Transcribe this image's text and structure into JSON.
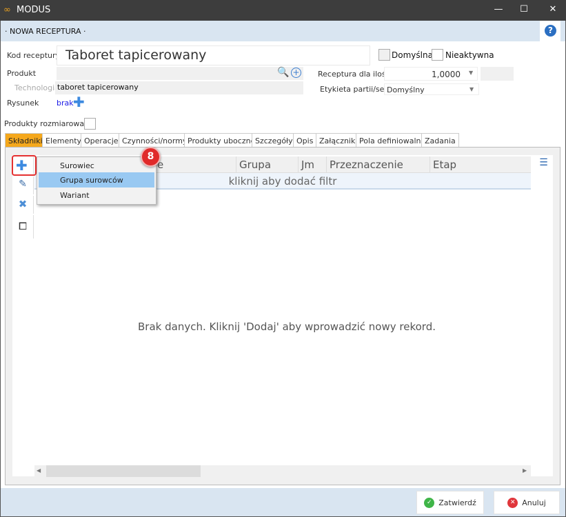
{
  "window": {
    "title": "MODUS",
    "minimize": "—",
    "maximize": "☐",
    "close": "✕"
  },
  "header": {
    "title": "· NOWA RECEPTURA ·",
    "help": "?"
  },
  "form": {
    "kod_label": "Kod receptury",
    "kod_value": "Taboret tapicerowany",
    "domyslna_label": "Domyślna",
    "nieaktywna_label": "Nieaktywna",
    "produkt_label": "Produkt",
    "produkt_value": "",
    "technologia_label": "Technologia",
    "technologia_value": "taboret tapicerowany",
    "rysunek_label": "Rysunek",
    "rysunek_value": "brak",
    "ilosc_label": "Receptura dla ilości",
    "ilosc_value": "1,0000",
    "etykieta_label": "Etykieta partii/serii",
    "etykieta_value": "Domyślny",
    "rozmiarowane_label": "Produkty rozmiarowane"
  },
  "tabs": [
    "Składniki",
    "Elementy",
    "Operacje",
    "Czynności/normy",
    "Produkty uboczne",
    "Szczegóły",
    "Opis",
    "Załączniki",
    "Pola definiowalne",
    "Zadania"
  ],
  "grid": {
    "columns": [
      "Grupa",
      "Jm",
      "Przeznaczenie",
      "Etap"
    ],
    "hidden_col_tail": "e",
    "filter_text": "kliknij aby dodać filtr",
    "empty_text": "Brak danych. Kliknij 'Dodaj' aby wprowadzić nowy rekord."
  },
  "menu": [
    "Surowiec",
    "Grupa surowców",
    "Wariant"
  ],
  "badge": "8",
  "footer": {
    "ok": "Zatwierdź",
    "cancel": "Anuluj"
  },
  "colors": {
    "accent_tab": "#f5a81c",
    "menu_highlight": "#99c9f2",
    "badge": "#e02a2a",
    "header": "#d9e5f1"
  }
}
